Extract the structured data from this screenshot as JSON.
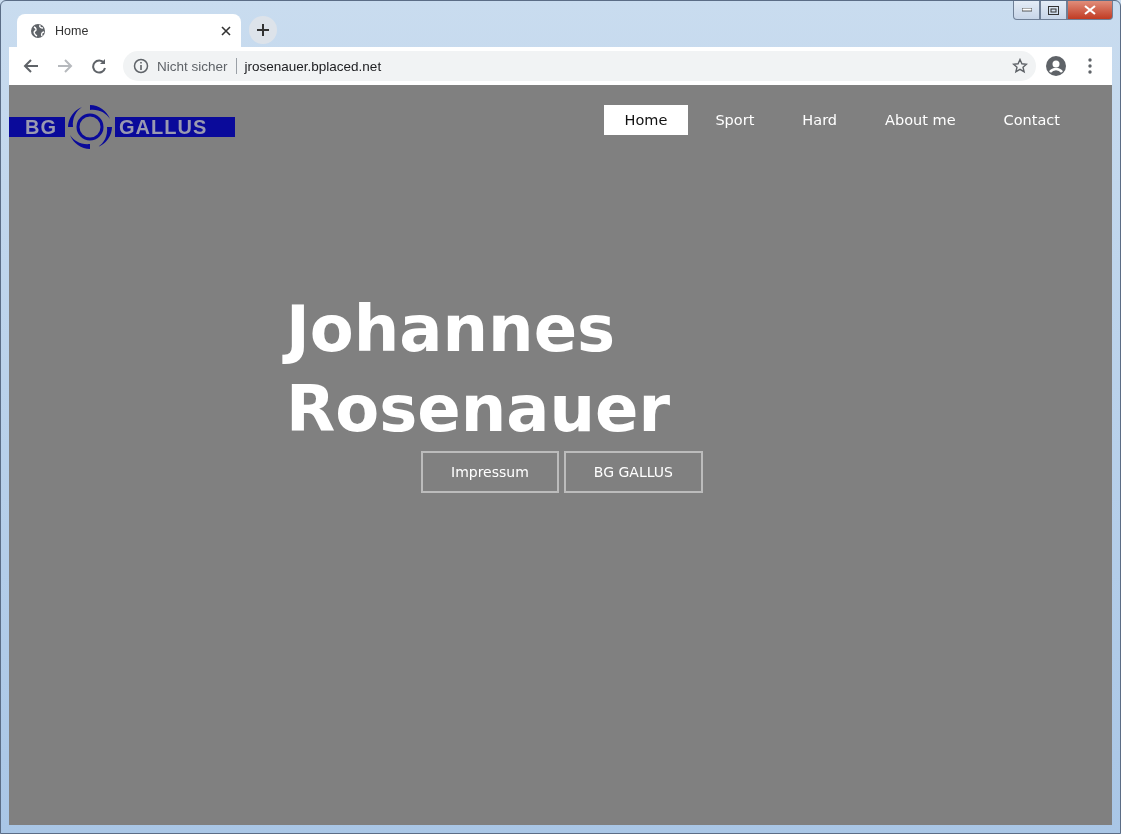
{
  "browser": {
    "tabs": [
      {
        "title": "Home",
        "selected": true
      }
    ],
    "address": {
      "security": "Nicht sicher",
      "url": "jrosenauer.bplaced.net"
    }
  },
  "site": {
    "logo": {
      "left": "BG",
      "right": "GALLUS"
    },
    "nav": [
      {
        "label": "Home",
        "selected": true
      },
      {
        "label": "Sport",
        "selected": false
      },
      {
        "label": "Hard",
        "selected": false
      },
      {
        "label": "About me",
        "selected": false
      },
      {
        "label": "Contact",
        "selected": false
      }
    ],
    "hero": {
      "title": "Johannes Rosenauer",
      "buttons": [
        "Impressum",
        "BG GALLUS"
      ]
    }
  }
}
